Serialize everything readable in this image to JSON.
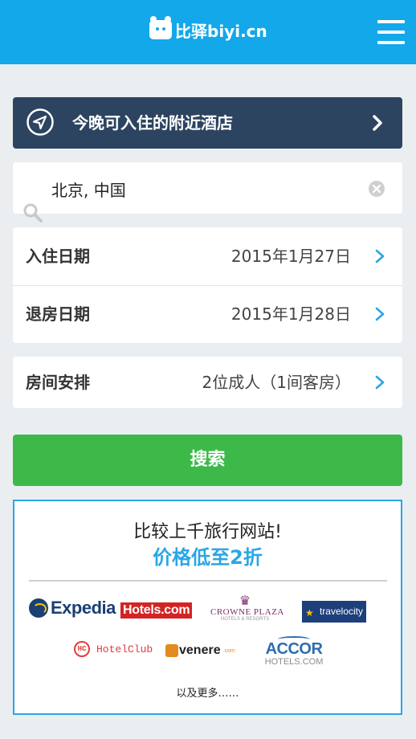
{
  "header": {
    "logo_text": "比驿biyi.cn",
    "menu_icon": "hamburger-menu-icon"
  },
  "nearby": {
    "label": "今晚可入住的附近酒店",
    "icon": "location-arrow-icon",
    "chevron_icon": "chevron-right-icon"
  },
  "search": {
    "value": "北京, 中国",
    "icon": "magnifier-icon",
    "clear_icon": "clear-circle-icon"
  },
  "booking": {
    "checkin_label": "入住日期",
    "checkin_value": "2015年1月27日",
    "checkout_label": "退房日期",
    "checkout_value": "2015年1月28日",
    "rooms_label": "房间安排",
    "rooms_value": "2位成人（1间客房）"
  },
  "search_button": {
    "label": "搜索"
  },
  "compare": {
    "title": "比较上千旅行网站!",
    "subtitle": "价格低至2折",
    "partners": {
      "expedia": "Expedia",
      "hotels": "Hotels.com",
      "crowne": "CROWNE PLAZA",
      "crowne_sub": "HOTELS & RESORTS",
      "travelocity": "travelocity",
      "hotelclub": "HotelClub",
      "hotelclub_mark": "HC",
      "venere": "venere",
      "venere_suffix": ".com",
      "accor": "ACCOR",
      "accor_sub": "HOTELS.COM"
    },
    "more": "以及更多……"
  },
  "colors": {
    "header": "#12a8ea",
    "nearby_bg": "#2c4460",
    "search_button": "#3db94a",
    "accent": "#2aa6e6",
    "page_bg": "#eaeef1"
  }
}
